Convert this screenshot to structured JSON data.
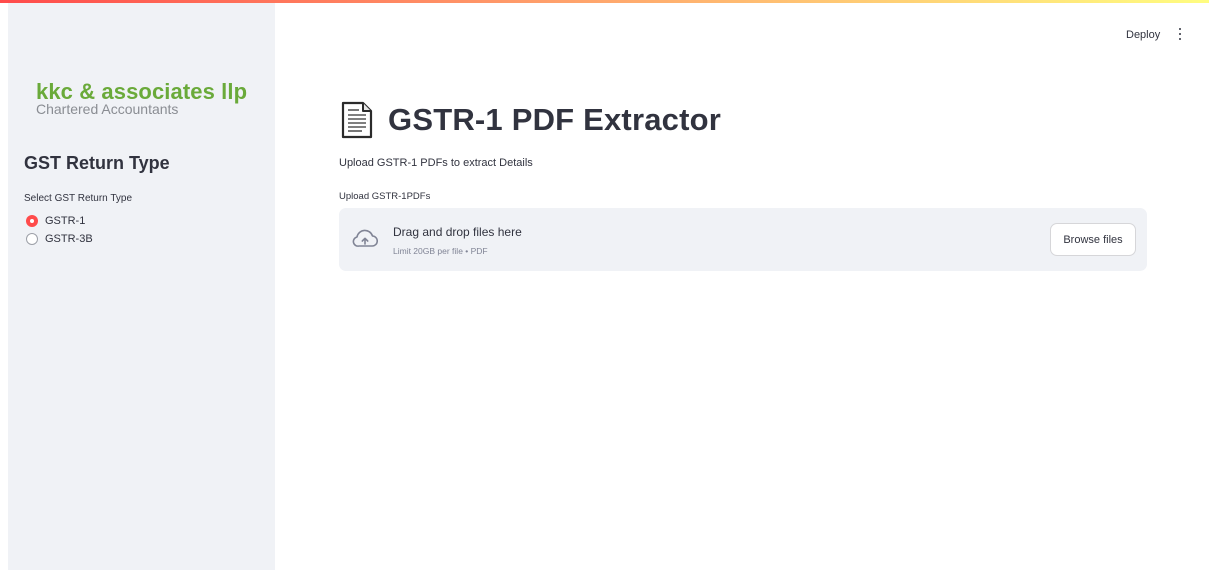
{
  "colors": {
    "accent": "#ff4b4b",
    "brand": "#6aaa3a",
    "sidebar_bg": "#f0f2f6",
    "text": "#31333f"
  },
  "header": {
    "deploy_label": "Deploy",
    "menu_icon": "vertical-ellipsis-icon"
  },
  "sidebar": {
    "brand_name": "kkc & associates llp",
    "brand_subtitle": "Chartered Accountants",
    "heading": "GST Return Type",
    "radio_label": "Select GST Return Type",
    "options": [
      {
        "label": "GSTR-1",
        "selected": true
      },
      {
        "label": "GSTR-3B",
        "selected": false
      }
    ]
  },
  "main": {
    "title_icon": "document-icon",
    "title": "GSTR-1 PDF Extractor",
    "subtitle": "Upload GSTR-1 PDFs to extract Details",
    "uploader": {
      "label": "Upload GSTR-1PDFs",
      "icon": "cloud-upload-icon",
      "drop_text": "Drag and drop files here",
      "limit_text": "Limit 20GB per file • PDF",
      "browse_label": "Browse files"
    }
  }
}
